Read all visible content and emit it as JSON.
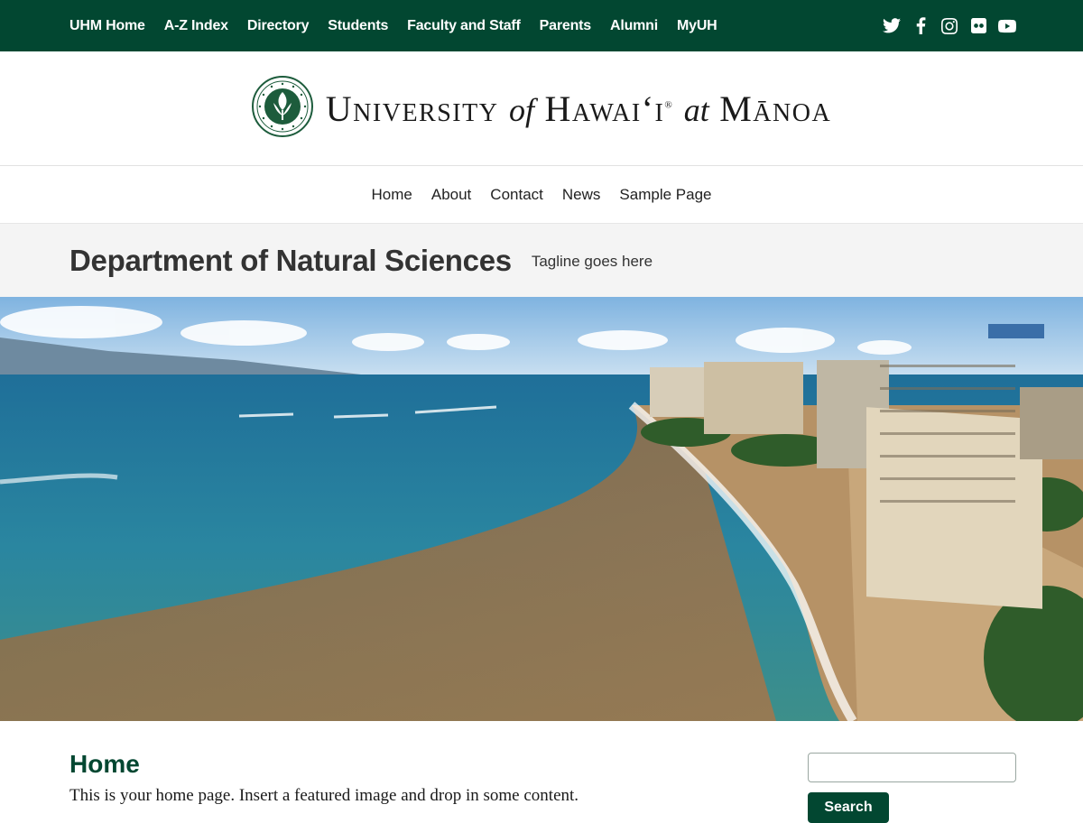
{
  "topbar": {
    "links": [
      "UHM Home",
      "A-Z Index",
      "Directory",
      "Students",
      "Faculty and Staff",
      "Parents",
      "Alumni",
      "MyUH"
    ],
    "social_icons": [
      "twitter-icon",
      "facebook-icon",
      "instagram-icon",
      "flickr-icon",
      "youtube-icon"
    ],
    "bg_color": "#024731"
  },
  "logo": {
    "seal_icon": "university-seal-icon",
    "word_university": "University",
    "word_of": "of",
    "word_hawaii": "Hawai‘i",
    "registered": "®",
    "word_at": "at",
    "word_manoa": "Mānoa"
  },
  "mainnav": {
    "items": [
      "Home",
      "About",
      "Contact",
      "News",
      "Sample Page"
    ]
  },
  "site": {
    "title": "Department of Natural Sciences",
    "tagline": "Tagline goes here"
  },
  "main": {
    "heading": "Home",
    "text": "This is your home page. Insert a featured image and drop in some content."
  },
  "sidebar": {
    "search_value": "",
    "search_button": "Search"
  },
  "colors": {
    "brand_green": "#024731",
    "band_gray": "#f4f4f4"
  }
}
